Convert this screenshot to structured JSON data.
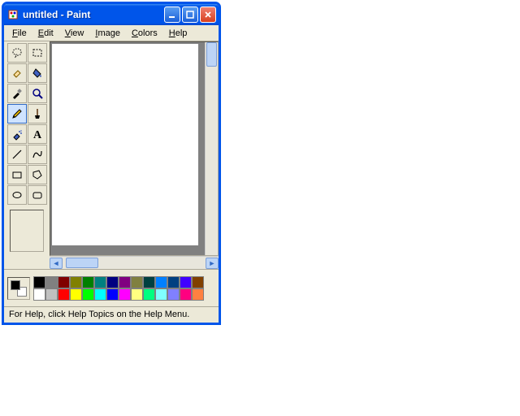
{
  "window": {
    "title": "untitled - Paint"
  },
  "menu": {
    "file": "File",
    "edit": "Edit",
    "view": "View",
    "image": "Image",
    "colors": "Colors",
    "help": "Help"
  },
  "tools": [
    {
      "name": "freeform-select",
      "icon": "freeform"
    },
    {
      "name": "select",
      "icon": "select"
    },
    {
      "name": "eraser",
      "icon": "eraser"
    },
    {
      "name": "fill",
      "icon": "fill"
    },
    {
      "name": "pick-color",
      "icon": "dropper"
    },
    {
      "name": "magnifier",
      "icon": "magnify"
    },
    {
      "name": "pencil",
      "icon": "pencil",
      "selected": true
    },
    {
      "name": "brush",
      "icon": "brush"
    },
    {
      "name": "airbrush",
      "icon": "airbrush"
    },
    {
      "name": "text",
      "icon": "text"
    },
    {
      "name": "line",
      "icon": "line"
    },
    {
      "name": "curve",
      "icon": "curve"
    },
    {
      "name": "rectangle",
      "icon": "rect"
    },
    {
      "name": "polygon",
      "icon": "poly"
    },
    {
      "name": "ellipse",
      "icon": "ellipse"
    },
    {
      "name": "rounded-rectangle",
      "icon": "rrect"
    }
  ],
  "palette": {
    "foreground": "#000000",
    "background": "#ffffff",
    "row1": [
      "#000000",
      "#808080",
      "#800000",
      "#808000",
      "#008000",
      "#008080",
      "#000080",
      "#800080",
      "#808040",
      "#004040",
      "#0080ff",
      "#004080",
      "#4000ff",
      "#804000"
    ],
    "row2": [
      "#ffffff",
      "#c0c0c0",
      "#ff0000",
      "#ffff00",
      "#00ff00",
      "#00ffff",
      "#0000ff",
      "#ff00ff",
      "#ffff80",
      "#00ff80",
      "#80ffff",
      "#8080ff",
      "#ff0080",
      "#ff8040"
    ]
  },
  "status": {
    "text": "For Help, click Help Topics on the Help Menu."
  }
}
